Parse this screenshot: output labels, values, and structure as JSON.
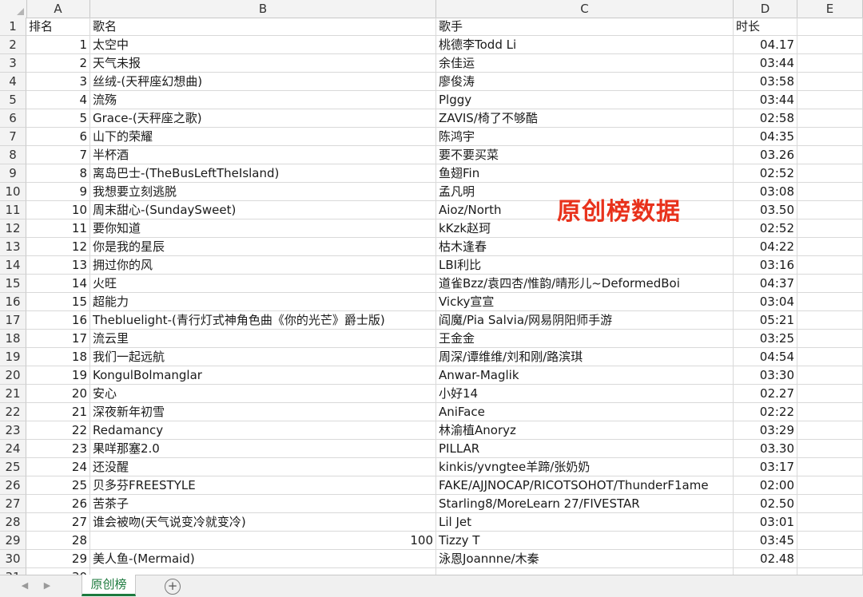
{
  "columns": [
    "A",
    "B",
    "C",
    "D",
    "E"
  ],
  "header": {
    "row_number": "1",
    "rank": "排名",
    "song": "歌名",
    "artist": "歌手",
    "duration": "时长"
  },
  "rows": [
    {
      "n": "2",
      "rank": "1",
      "song": "太空中",
      "artist": "桃德李Todd Li",
      "duration": "04.17"
    },
    {
      "n": "3",
      "rank": "2",
      "song": "天气未报",
      "artist": "余佳运",
      "duration": "03:44"
    },
    {
      "n": "4",
      "rank": "3",
      "song": "丝绒-(天秤座幻想曲)",
      "artist": "廖俊涛",
      "duration": "03:58"
    },
    {
      "n": "5",
      "rank": "4",
      "song": "流殇",
      "artist": "Plggy",
      "duration": "03:44"
    },
    {
      "n": "6",
      "rank": "5",
      "song": "Grace-(天秤座之歌)",
      "artist": "ZAVIS/椅了不够酷",
      "duration": "02:58"
    },
    {
      "n": "7",
      "rank": "6",
      "song": "山下的荣耀",
      "artist": "陈鸿宇",
      "duration": "04:35"
    },
    {
      "n": "8",
      "rank": "7",
      "song": "半杯酒",
      "artist": "要不要买菜",
      "duration": "03.26"
    },
    {
      "n": "9",
      "rank": "8",
      "song": "离岛巴士-(TheBusLeftTheIsland)",
      "artist": "鱼翅Fin",
      "duration": "02:52"
    },
    {
      "n": "10",
      "rank": "9",
      "song": "我想要立刻逃脱",
      "artist": "孟凡明",
      "duration": "03:08"
    },
    {
      "n": "11",
      "rank": "10",
      "song": "周末甜心-(SundaySweet)",
      "artist": "Aioz/North",
      "duration": "03.50"
    },
    {
      "n": "12",
      "rank": "11",
      "song": "要你知道",
      "artist": "kKzk赵珂",
      "duration": "02:52"
    },
    {
      "n": "13",
      "rank": "12",
      "song": "你是我的星辰",
      "artist": "枯木逢春",
      "duration": "04:22"
    },
    {
      "n": "14",
      "rank": "13",
      "song": "拥过你的风",
      "artist": "LBI利比",
      "duration": "03:16"
    },
    {
      "n": "15",
      "rank": "14",
      "song": "火旺",
      "artist": "道雀Bzz/袁四杏/惟韵/晴形儿~DeformedBoi",
      "duration": "04:37"
    },
    {
      "n": "16",
      "rank": "15",
      "song": "超能力",
      "artist": "Vicky宣宣",
      "duration": "03:04"
    },
    {
      "n": "17",
      "rank": "16",
      "song": "Thebluelight-(青行灯式神角色曲《你的光芒》爵士版)",
      "artist": "阎魔/Pia Salvia/网易阴阳师手游",
      "duration": "05:21"
    },
    {
      "n": "18",
      "rank": "17",
      "song": "流云里",
      "artist": "王金金",
      "duration": "03:25"
    },
    {
      "n": "19",
      "rank": "18",
      "song": "我们一起远航",
      "artist": "周深/谭维维/刘和刚/路滨琪",
      "duration": "04:54"
    },
    {
      "n": "20",
      "rank": "19",
      "song": "KongulBolmanglar",
      "artist": "Anwar-Maglik",
      "duration": "03:30"
    },
    {
      "n": "21",
      "rank": "20",
      "song": "安心",
      "artist": "小好14",
      "duration": "02.27"
    },
    {
      "n": "22",
      "rank": "21",
      "song": "深夜新年初雪",
      "artist": "AniFace",
      "duration": "02:22"
    },
    {
      "n": "23",
      "rank": "22",
      "song": "Redamancy",
      "artist": "林渝植Anoryz",
      "duration": "03:29"
    },
    {
      "n": "24",
      "rank": "23",
      "song": "果咩那塞2.0",
      "artist": "PILLAR",
      "duration": "03.30"
    },
    {
      "n": "25",
      "rank": "24",
      "song": "还没醒",
      "artist": "kinkis/yvngtee羊蹄/张奶奶",
      "duration": "03:17"
    },
    {
      "n": "26",
      "rank": "25",
      "song": "贝多芬FREESTYLE",
      "artist": "FAKE/AJJNOCAP/RICOTSOHOT/ThunderF1ame",
      "duration": "02:00"
    },
    {
      "n": "27",
      "rank": "26",
      "song": "苦茶子",
      "artist": "Starling8/MoreLearn 27/FIVESTAR",
      "duration": "02.50"
    },
    {
      "n": "28",
      "rank": "27",
      "song": "谁会被吻(天气说变冷就变冷)",
      "artist": "Lil Jet",
      "duration": "03:01"
    },
    {
      "n": "29",
      "rank": "28",
      "song": "100",
      "artist": "Tizzy T",
      "duration": "03:45"
    },
    {
      "n": "30",
      "rank": "29",
      "song": "美人鱼-(Mermaid)",
      "artist": "泳恩Joannne/木秦",
      "duration": "02.48"
    },
    {
      "n": "31",
      "rank": "30",
      "song": "",
      "artist": "",
      "duration": ""
    }
  ],
  "overlay_text": "原创榜数据",
  "sheet_tab": "原创榜",
  "add_sheet_symbol": "+",
  "nav_prev": "◀",
  "nav_next": "▶",
  "colors": {
    "overlay": "#e8321c",
    "tab_accent": "#1d7a3e"
  }
}
